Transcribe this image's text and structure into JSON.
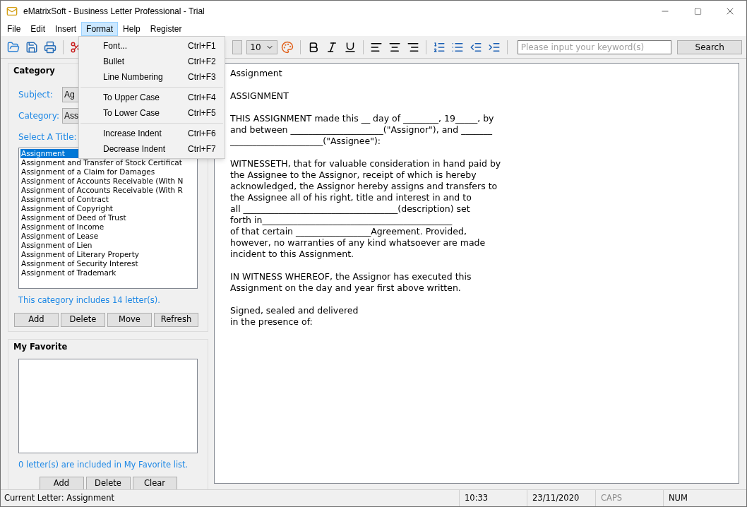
{
  "window": {
    "title": "eMatrixSoft - Business Letter Professional - Trial"
  },
  "menubar": [
    {
      "label": "File",
      "selected": false
    },
    {
      "label": "Edit",
      "selected": false
    },
    {
      "label": "Insert",
      "selected": false
    },
    {
      "label": "Format",
      "selected": true
    },
    {
      "label": "Help",
      "selected": false
    },
    {
      "label": "Register",
      "selected": false
    }
  ],
  "format_menu": [
    [
      {
        "label": "Font...",
        "shortcut": "Ctrl+F1"
      },
      {
        "label": "Bullet",
        "shortcut": "Ctrl+F2"
      },
      {
        "label": "Line Numbering",
        "shortcut": "Ctrl+F3"
      }
    ],
    [
      {
        "label": "To Upper Case",
        "shortcut": "Ctrl+F4"
      },
      {
        "label": "To Lower Case",
        "shortcut": "Ctrl+F5"
      }
    ],
    [
      {
        "label": "Increase Indent",
        "shortcut": "Ctrl+F6"
      },
      {
        "label": "Decrease Indent",
        "shortcut": "Ctrl+F7"
      }
    ]
  ],
  "toolbar": {
    "font_size": "10",
    "search": {
      "placeholder": "Please input your keyword(s)"
    },
    "search_button": "Search"
  },
  "category": {
    "title": "Category",
    "subject_label": "Subject:",
    "subject_value": "Ag",
    "category_label": "Category:",
    "category_value": "Ass",
    "title_label": "Select A Title:",
    "titles": [
      {
        "label": "Assignment",
        "selected": true
      },
      {
        "label": "Assignment and Transfer of Stock Certificat",
        "selected": false
      },
      {
        "label": "Assignment of a Claim for Damages",
        "selected": false
      },
      {
        "label": "Assignment of Accounts Receivable (With N",
        "selected": false
      },
      {
        "label": "Assignment of Accounts Receivable (With R",
        "selected": false
      },
      {
        "label": "Assignment of Contract",
        "selected": false
      },
      {
        "label": "Assignment of Copyright",
        "selected": false
      },
      {
        "label": "Assignment of Deed of Trust",
        "selected": false
      },
      {
        "label": "Assignment of Income",
        "selected": false
      },
      {
        "label": "Assignment of Lease",
        "selected": false
      },
      {
        "label": "Assignment of Lien",
        "selected": false
      },
      {
        "label": "Assignment of Literary Property",
        "selected": false
      },
      {
        "label": "Assignment of Security Interest",
        "selected": false
      },
      {
        "label": "Assignment of Trademark",
        "selected": false
      }
    ],
    "count_text": "This category includes 14 letter(s).",
    "buttons": [
      "Add",
      "Delete",
      "Move",
      "Refresh"
    ]
  },
  "favorite": {
    "title": "My Favorite",
    "count_text": "0 letter(s) are included in My Favorite list.",
    "buttons": [
      "Add",
      "Delete",
      "Clear"
    ]
  },
  "document": [
    [
      "Assignment"
    ],
    [
      "ASSIGNMENT"
    ],
    [
      "THIS ASSIGNMENT made this __ day of ________, 19_____, by",
      "and between _____________________(\"Assignor\"), and _______",
      "_____________________(\"Assignee\"):"
    ],
    [
      "WITNESSETH, that for valuable consideration in hand paid by",
      "the Assignee to the Assignor, receipt of which is hereby",
      "acknowledged, the Assignor hereby assigns and transfers to",
      "the Assignee all of his right, title and interest in and to",
      "all ___________________________________(description) set",
      "forth in___________________________________________",
      "of that certain _________________Agreement. Provided,",
      "however, no warranties of any kind whatsoever are made",
      "incident to this Assignment."
    ],
    [
      "IN WITNESS WHEREOF, the Assignor has executed this",
      "Assignment on the day and year first above written."
    ],
    [
      "Signed, sealed and delivered",
      "in the presence of:"
    ]
  ],
  "status_bar": {
    "current": "Current Letter: Assignment",
    "time": "10:33",
    "date": "23/11/2020",
    "indicators": [
      {
        "label": "CAPS",
        "on": false
      },
      {
        "label": "NUM",
        "on": true
      }
    ]
  }
}
